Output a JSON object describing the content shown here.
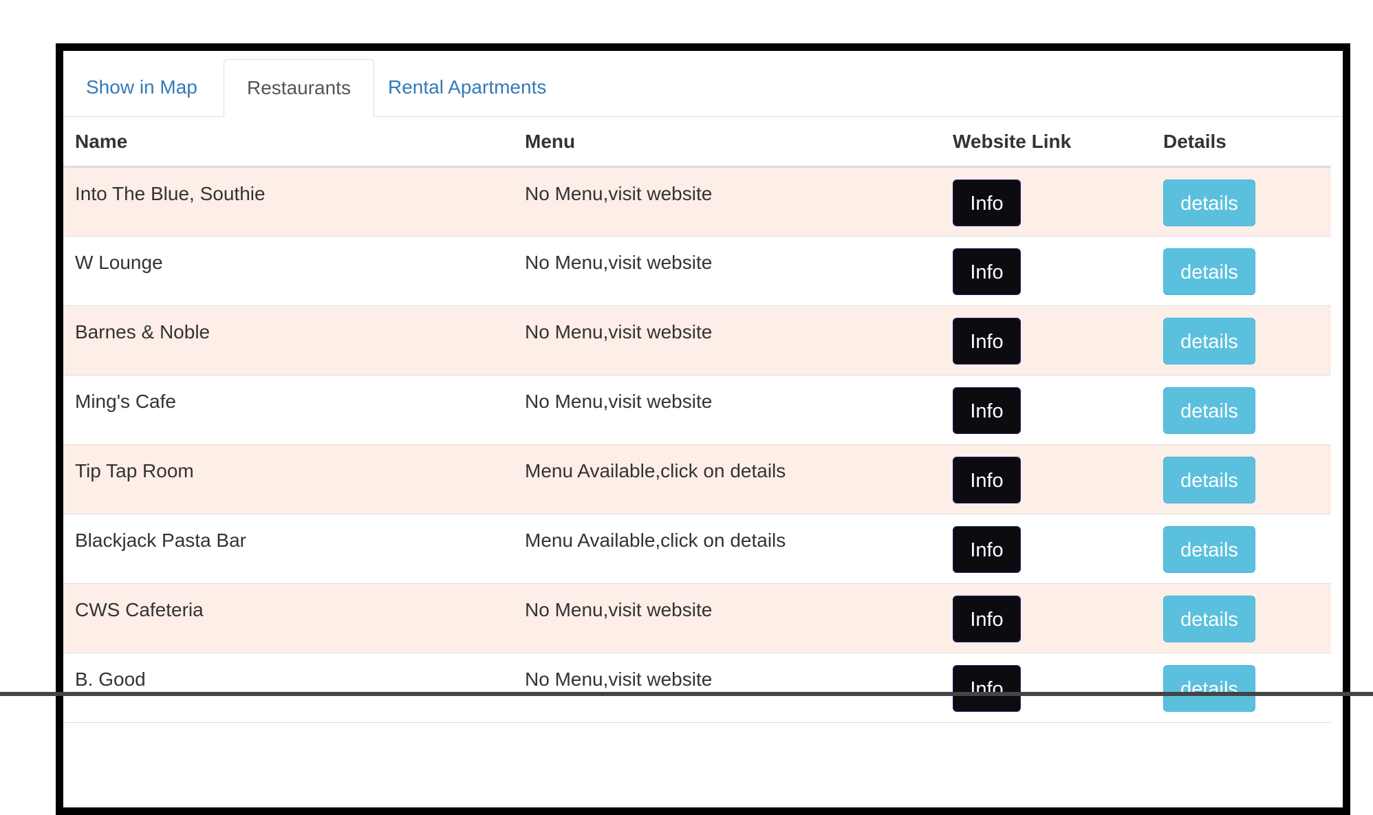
{
  "tabs": [
    {
      "label": "Show in Map",
      "active": false
    },
    {
      "label": "Restaurants",
      "active": true
    },
    {
      "label": "Rental Apartments",
      "active": false
    }
  ],
  "table": {
    "headers": [
      "Name",
      "Menu",
      "Website Link",
      "Details"
    ],
    "info_label": "Info",
    "details_label": "details",
    "rows": [
      {
        "name": "Into The Blue, Southie",
        "menu": "No Menu,visit website"
      },
      {
        "name": "W Lounge",
        "menu": "No Menu,visit website"
      },
      {
        "name": "Barnes & Noble",
        "menu": "No Menu,visit website"
      },
      {
        "name": "Ming's Cafe",
        "menu": "No Menu,visit website"
      },
      {
        "name": "Tip Tap Room",
        "menu": "Menu Available,click on details"
      },
      {
        "name": "Blackjack Pasta Bar",
        "menu": "Menu Available,click on details"
      },
      {
        "name": "CWS Cafeteria",
        "menu": "No Menu,visit website"
      },
      {
        "name": "B. Good",
        "menu": "No Menu,visit website"
      }
    ]
  },
  "colors": {
    "tab_link": "#337ab7",
    "stripe": "#fdeee7",
    "info_button": "#0c0b10",
    "details_button": "#5bc0de"
  }
}
